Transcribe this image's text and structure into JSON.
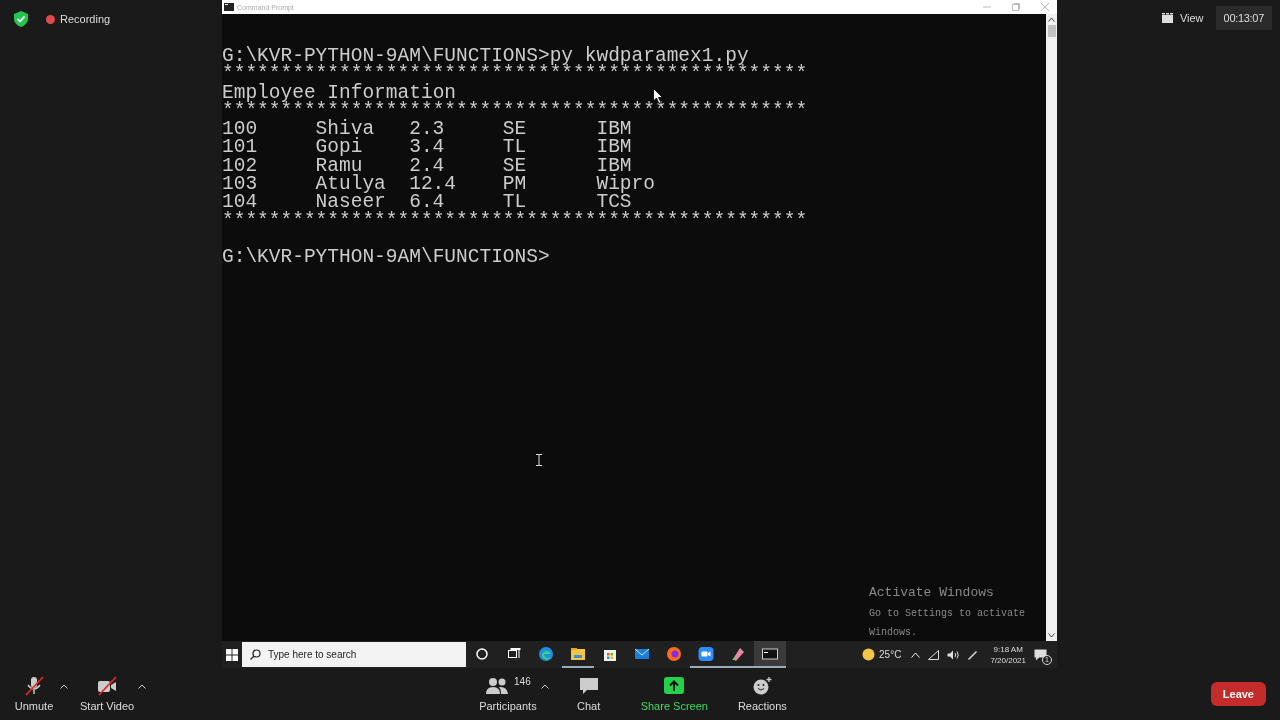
{
  "meeting_top": {
    "recording": "Recording",
    "view": "View",
    "timer": "00:13:07"
  },
  "window": {
    "title": "Command Prompt"
  },
  "console": {
    "lines": [
      {
        "kind": "text",
        "text": "G:\\KVR-PYTHON-9AM\\FUNCTIONS>py kwdparamex1.py"
      },
      {
        "kind": "text",
        "text": "**************************************************"
      },
      {
        "kind": "text",
        "text": "Employee Information"
      },
      {
        "kind": "text",
        "text": "**************************************************"
      },
      {
        "kind": "row",
        "cells": [
          "100",
          "Shiva",
          "2.3",
          "SE",
          "IBM"
        ]
      },
      {
        "kind": "row",
        "cells": [
          "101",
          "Gopi",
          "3.4",
          "TL",
          "IBM"
        ]
      },
      {
        "kind": "row",
        "cells": [
          "102",
          "Ramu",
          "2.4",
          "SE",
          "IBM"
        ]
      },
      {
        "kind": "row",
        "cells": [
          "103",
          "Atulya",
          "12.4",
          "PM",
          "Wipro"
        ]
      },
      {
        "kind": "row",
        "cells": [
          "104",
          "Naseer",
          "6.4",
          "TL",
          "TCS"
        ]
      },
      {
        "kind": "text",
        "text": "**************************************************"
      },
      {
        "kind": "blank"
      },
      {
        "kind": "text",
        "text": "G:\\KVR-PYTHON-9AM\\FUNCTIONS>"
      }
    ],
    "activation_title": "Activate Windows",
    "activation_text": "Go to Settings to activate Windows."
  },
  "taskbar": {
    "search": {
      "placeholder": "Type here to search"
    },
    "apps": [
      {
        "kind": "cortana",
        "running": false,
        "selected": false
      },
      {
        "kind": "taskview",
        "running": false,
        "selected": false
      },
      {
        "kind": "edge",
        "running": false,
        "selected": false
      },
      {
        "kind": "explorer",
        "running": true,
        "selected": false
      },
      {
        "kind": "store",
        "running": false,
        "selected": false
      },
      {
        "kind": "mail",
        "running": false,
        "selected": false
      },
      {
        "kind": "firefox",
        "running": false,
        "selected": false
      },
      {
        "kind": "zoom",
        "running": true,
        "selected": false
      },
      {
        "kind": "paint",
        "running": true,
        "selected": false
      },
      {
        "kind": "cmd",
        "running": true,
        "selected": true
      }
    ],
    "temperature": "25°C",
    "time": "9:18 AM",
    "date": "7/20/2021",
    "notifications": "1"
  },
  "meeting_bar": {
    "controls": [
      {
        "kind": "mic",
        "label": "Unmute",
        "off": true
      },
      {
        "kind": "video",
        "label": "Start Video",
        "off": true
      },
      {
        "kind": "participants",
        "label": "Participants",
        "count": "146"
      },
      {
        "kind": "chat",
        "label": "Chat"
      },
      {
        "kind": "share",
        "label": "Share Screen"
      },
      {
        "kind": "reactions",
        "label": "Reactions"
      }
    ],
    "leave": "Leave"
  }
}
